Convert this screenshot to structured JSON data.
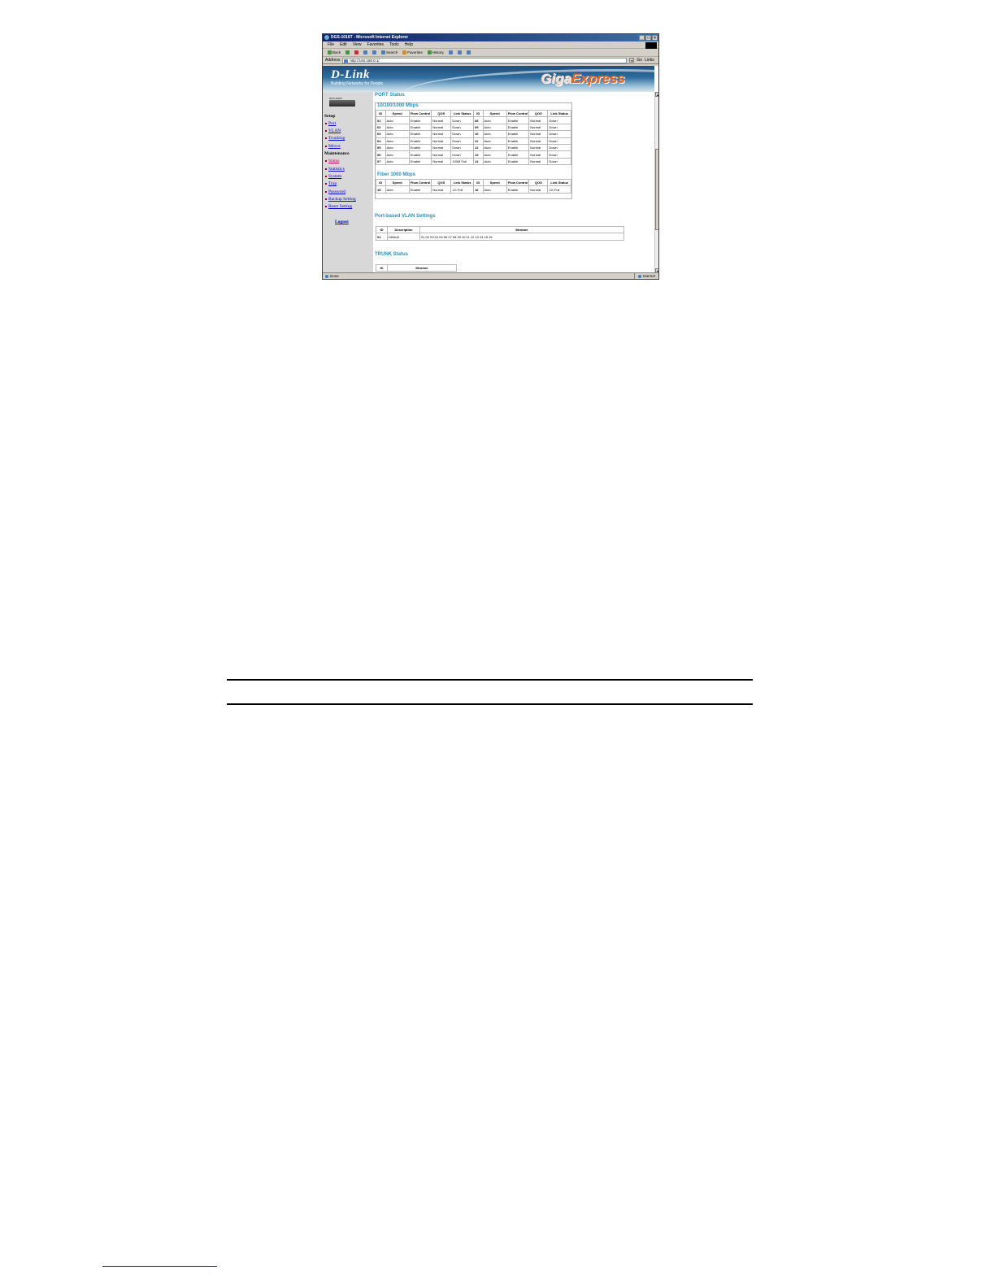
{
  "window": {
    "title": "DGS-1016T - Microsoft Internet Explorer",
    "controls": [
      "_",
      "□",
      "×"
    ]
  },
  "menu": [
    "File",
    "Edit",
    "View",
    "Favorites",
    "Tools",
    "Help"
  ],
  "toolbar": {
    "back": "Back",
    "search": "Search",
    "favorites": "Favorites",
    "history": "History"
  },
  "address": {
    "label": "Address",
    "url": "http://192.168.0.1/",
    "go": "Go",
    "links": "Links"
  },
  "banner": {
    "logo": "D-Link",
    "tagline": "Building Networks for People",
    "product_a": "Giga",
    "product_b": "Express"
  },
  "sidebar": {
    "model": "DGS-1016T",
    "setup_heading": "Setup",
    "setup_items": [
      "Port",
      "VLAN",
      "Trunking",
      "Mirror"
    ],
    "maintenance_heading": "Maintenance",
    "maintenance_items": [
      "Status",
      "Statistics",
      "System",
      "Trap",
      "Password",
      "Backup Setting",
      "Reset Setting"
    ],
    "logout": "Logout"
  },
  "port_status": {
    "title": "PORT Status",
    "copper_title": "10/100/1000 Mbps",
    "fiber_title": "Fiber 1000 Mbps",
    "headers": [
      "ID",
      "Speed",
      "Flow Control",
      "QOS",
      "Link Status",
      "ID",
      "Speed",
      "Flow Control",
      "QOS",
      "Link Status"
    ],
    "copper_rows": [
      [
        "01",
        "Auto",
        "Enable",
        "Normal",
        "Down",
        "08",
        "Auto",
        "Enable",
        "Normal",
        "Down"
      ],
      [
        "02",
        "Auto",
        "Enable",
        "Normal",
        "Down",
        "09",
        "Auto",
        "Enable",
        "Normal",
        "Down"
      ],
      [
        "03",
        "Auto",
        "Enable",
        "Normal",
        "Down",
        "10",
        "Auto",
        "Enable",
        "Normal",
        "Down"
      ],
      [
        "04",
        "Auto",
        "Enable",
        "Normal",
        "Down",
        "11",
        "Auto",
        "Enable",
        "Normal",
        "Down"
      ],
      [
        "05",
        "Auto",
        "Enable",
        "Normal",
        "Down",
        "12",
        "Auto",
        "Enable",
        "Normal",
        "Down"
      ],
      [
        "06",
        "Auto",
        "Enable",
        "Normal",
        "Down",
        "13",
        "Auto",
        "Enable",
        "Normal",
        "Down"
      ],
      [
        "07",
        "Auto",
        "Enable",
        "Normal",
        "100M Full",
        "14",
        "Auto",
        "Enable",
        "Normal",
        "Down"
      ]
    ],
    "fiber_rows": [
      [
        "15",
        "Auto",
        "Enable",
        "Normal",
        "1G Full",
        "16",
        "Auto",
        "Enable",
        "Normal",
        "1G Full"
      ]
    ]
  },
  "vlan": {
    "title": "Port-based VLAN Settings",
    "headers": [
      "ID",
      "Description",
      "Member"
    ],
    "rows": [
      [
        "01",
        "Default",
        "01 02 03 04 05 06 07 08 09 10 11 12 13 14 15 16"
      ]
    ]
  },
  "trunk": {
    "title": "TRUNK Status",
    "headers": [
      "ID",
      "Member"
    ]
  },
  "status": {
    "text": "Done",
    "zone": "Internet"
  }
}
